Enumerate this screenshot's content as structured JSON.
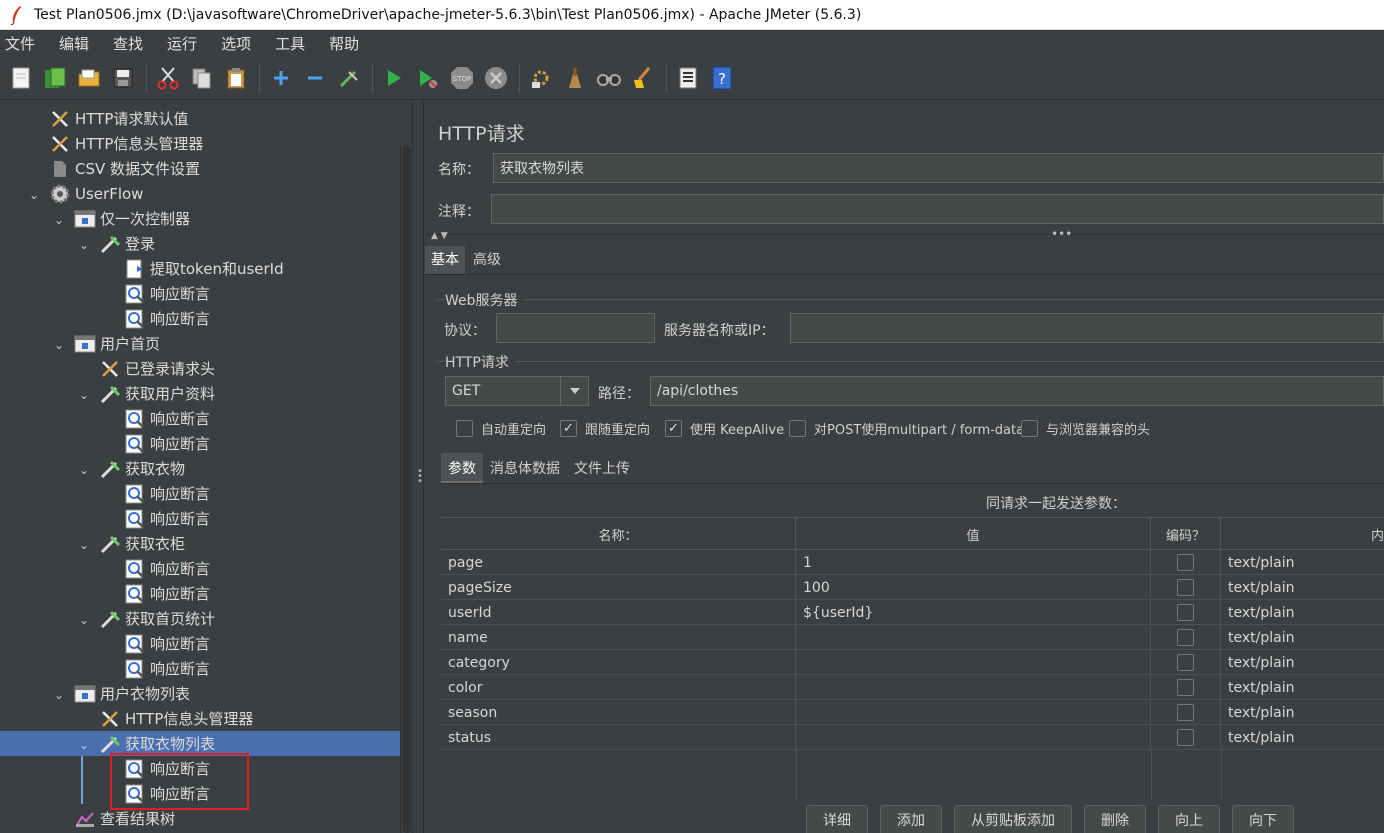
{
  "window": {
    "title": "Test Plan0506.jmx (D:\\javasoftware\\ChromeDriver\\apache-jmeter-5.6.3\\bin\\Test Plan0506.jmx) - Apache JMeter (5.6.3)"
  },
  "menu": [
    "文件",
    "编辑",
    "查找",
    "运行",
    "选项",
    "工具",
    "帮助"
  ],
  "toolbar": [
    "new-icon",
    "templates-icon",
    "open-icon",
    "save-icon",
    "cut-icon",
    "copy-icon",
    "paste-icon",
    "expand-icon",
    "collapse-icon",
    "toggle-icon",
    "start-icon",
    "start-no-pause-icon",
    "stop-icon",
    "shutdown-icon",
    "clear-icon",
    "clear-all-icon",
    "search-icon",
    "reset-search-icon",
    "function-helper-icon",
    "help-icon"
  ],
  "tree": {
    "nodes": [
      {
        "label": "HTTP请求默认值",
        "icon": "config-icon"
      },
      {
        "label": "HTTP信息头管理器",
        "icon": "config-icon"
      },
      {
        "label": "CSV 数据文件设置",
        "icon": "csv-icon"
      },
      {
        "label": "UserFlow",
        "icon": "thread-group-icon"
      },
      {
        "label": "仅一次控制器",
        "icon": "controller-icon"
      },
      {
        "label": "登录",
        "icon": "sampler-icon"
      },
      {
        "label": "提取token和userId",
        "icon": "extractor-icon"
      },
      {
        "label": "响应断言",
        "icon": "assertion-icon"
      },
      {
        "label": "响应断言",
        "icon": "assertion-icon"
      },
      {
        "label": "用户首页",
        "icon": "controller-icon"
      },
      {
        "label": "已登录请求头",
        "icon": "config-icon"
      },
      {
        "label": "获取用户资料",
        "icon": "sampler-icon"
      },
      {
        "label": "响应断言",
        "icon": "assertion-icon"
      },
      {
        "label": "响应断言",
        "icon": "assertion-icon"
      },
      {
        "label": "获取衣物",
        "icon": "sampler-icon"
      },
      {
        "label": "响应断言",
        "icon": "assertion-icon"
      },
      {
        "label": "响应断言",
        "icon": "assertion-icon"
      },
      {
        "label": "获取衣柜",
        "icon": "sampler-icon"
      },
      {
        "label": "响应断言",
        "icon": "assertion-icon"
      },
      {
        "label": "响应断言",
        "icon": "assertion-icon"
      },
      {
        "label": "获取首页统计",
        "icon": "sampler-icon"
      },
      {
        "label": "响应断言",
        "icon": "assertion-icon"
      },
      {
        "label": "响应断言",
        "icon": "assertion-icon"
      },
      {
        "label": "用户衣物列表",
        "icon": "controller-icon"
      },
      {
        "label": "HTTP信息头管理器",
        "icon": "config-icon"
      },
      {
        "label": "获取衣物列表",
        "icon": "sampler-icon"
      },
      {
        "label": "响应断言",
        "icon": "assertion-icon"
      },
      {
        "label": "响应断言",
        "icon": "assertion-icon"
      },
      {
        "label": "查看结果树",
        "icon": "listener-icon"
      }
    ],
    "selected": "获取衣物列表"
  },
  "panel": {
    "title": "HTTP请求",
    "name_label": "名称：",
    "name_value": "获取衣物列表",
    "comment_label": "注释：",
    "comment_value": "",
    "tabs": [
      "基本",
      "高级"
    ],
    "web_server": {
      "group": "Web服务器",
      "protocol_label": "协议：",
      "protocol_value": "",
      "server_label": "服务器名称或IP：",
      "server_value": ""
    },
    "http_request": {
      "group": "HTTP请求",
      "method": "GET",
      "path_label": "路径：",
      "path_value": "/api/clothes"
    },
    "options": [
      {
        "label": "自动重定向",
        "checked": false
      },
      {
        "label": "跟随重定向",
        "checked": true
      },
      {
        "label": "使用 KeepAlive",
        "checked": true
      },
      {
        "label": "对POST使用multipart / form-data",
        "checked": false
      },
      {
        "label": "与浏览器兼容的头",
        "checked": false
      }
    ],
    "param_tabs": [
      "参数",
      "消息体数据",
      "文件上传"
    ],
    "params_caption": "同请求一起发送参数：",
    "columns": [
      "名称：",
      "值",
      "编码？",
      "内"
    ],
    "rows": [
      {
        "name": "page",
        "value": "1",
        "encode": false,
        "type": "text/plain"
      },
      {
        "name": "pageSize",
        "value": "100",
        "encode": false,
        "type": "text/plain"
      },
      {
        "name": "userId",
        "value": "${userId}",
        "encode": false,
        "type": "text/plain"
      },
      {
        "name": "name",
        "value": "",
        "encode": false,
        "type": "text/plain"
      },
      {
        "name": "category",
        "value": "",
        "encode": false,
        "type": "text/plain"
      },
      {
        "name": "color",
        "value": "",
        "encode": false,
        "type": "text/plain"
      },
      {
        "name": "season",
        "value": "",
        "encode": false,
        "type": "text/plain"
      },
      {
        "name": "status",
        "value": "",
        "encode": false,
        "type": "text/plain"
      }
    ],
    "buttons": [
      "详细",
      "添加",
      "从剪贴板添加",
      "删除",
      "向上",
      "向下"
    ]
  },
  "colors": {
    "selection": "#4b6eaf",
    "highlight_box": "#e02020",
    "background": "#3c3f41"
  }
}
